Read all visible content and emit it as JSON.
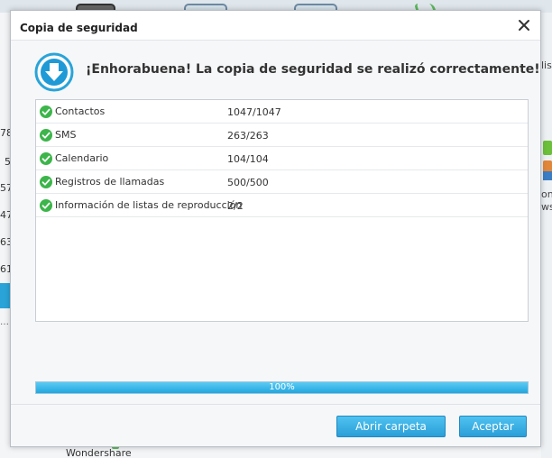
{
  "background": {
    "left_numbers": [
      "78",
      "5",
      "57",
      "47",
      "63",
      "61"
    ],
    "right_fragments": [
      "lisp",
      "ont",
      "ws"
    ],
    "bottom_label": "Wondershare"
  },
  "dialog": {
    "title": "Copia de seguridad",
    "close_icon": "close-icon",
    "success_icon": "download-arrow-icon",
    "message": "¡Enhorabuena! La copia de seguridad se realizó correctamente!",
    "results": [
      {
        "label": "Contactos",
        "value": "1047/1047",
        "icon": "check-icon"
      },
      {
        "label": "SMS",
        "value": "263/263",
        "icon": "check-icon"
      },
      {
        "label": "Calendario",
        "value": "104/104",
        "icon": "check-icon"
      },
      {
        "label": "Registros de llamadas",
        "value": "500/500",
        "icon": "check-icon"
      },
      {
        "label": "Información de listas de reproducción",
        "value": "2/2",
        "icon": "check-icon"
      }
    ],
    "progress": {
      "percent": 100,
      "label": "100%"
    },
    "buttons": {
      "open_folder": "Abrir carpeta",
      "accept": "Aceptar"
    }
  },
  "colors": {
    "accent": "#2aa4d8",
    "success_green": "#3cb54a",
    "progress_fill": "#22a6df"
  }
}
